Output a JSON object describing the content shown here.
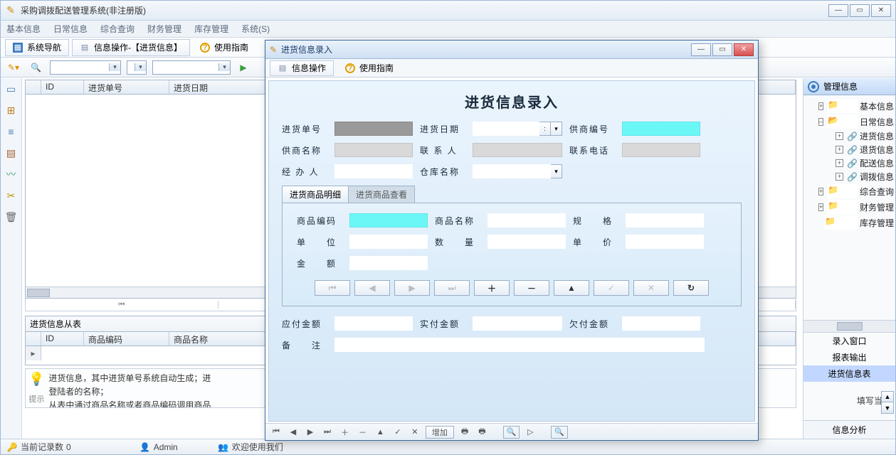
{
  "app": {
    "title": "采购调拨配送管理系统(非注册版)"
  },
  "menu": [
    "基本信息",
    "日常信息",
    "综合查询",
    "财务管理",
    "库存管理",
    "系统(S)"
  ],
  "main_tabs": [
    {
      "label": "系统导航"
    },
    {
      "label": "信息操作-【进货信息】"
    },
    {
      "label": "使用指南"
    }
  ],
  "grid1": {
    "cols": [
      "ID",
      "进货单号",
      "进货日期"
    ]
  },
  "nav_glyphs": [
    "⏮",
    "◀",
    "▶",
    "⏭"
  ],
  "sub_panel_title": "进货信息从表",
  "grid2": {
    "cols": [
      "ID",
      "商品编码",
      "商品名称"
    ]
  },
  "tip": {
    "line1": "进货信息，其中进货单号系统自动生成；进",
    "line2": "登陆者的名称；",
    "line3": "从表中通过商品名称或者商品编码调用商品",
    "label": "提示"
  },
  "tip_right": "填写当前",
  "right": {
    "title": "管理信息",
    "tree": {
      "n1": "基本信息",
      "n2": "日常信息",
      "n2c": [
        "进货信息",
        "退货信息",
        "配送信息",
        "调拨信息"
      ],
      "n3": "综合查询",
      "n4": "财务管理",
      "n5": "库存管理"
    },
    "list": [
      "录入窗口",
      "报表输出",
      "进货信息表"
    ],
    "foot": "信息分析"
  },
  "status": {
    "records_label": "当前记录数",
    "records_value": "0",
    "user": "Admin",
    "welcome": "欢迎使用我们"
  },
  "dialog": {
    "title": "进货信息录入",
    "tabs": [
      "信息操作",
      "使用指南"
    ],
    "heading": "进货信息录入",
    "labels": {
      "order_no": "进货单号",
      "order_date": "进货日期",
      "supplier_no": "供商编号",
      "supplier_name": "供商名称",
      "contact": "联 系 人",
      "phone": "联系电话",
      "operator": "经 办 人",
      "warehouse": "仓库名称",
      "tab_detail": "进货商品明细",
      "tab_view": "进货商品查看",
      "prod_code": "商品编码",
      "prod_name": "商品名称",
      "spec": "规　　格",
      "unit": "单　　位",
      "qty": "数　　量",
      "price": "单　　价",
      "amount": "金　　额",
      "due": "应付金额",
      "paid": "实付金额",
      "debt": "欠付金额",
      "remark": "备　　注"
    },
    "rec_nav": [
      "⏮",
      "◀",
      "▶",
      "⏭",
      "＋",
      "－",
      "▲",
      "✓",
      "✕",
      "↻"
    ],
    "bottom": {
      "add_label": "增加",
      "nav": [
        "⏮",
        "◀",
        "▶",
        "⏭",
        "＋",
        "－",
        "▲",
        "✓",
        "✕"
      ]
    }
  }
}
